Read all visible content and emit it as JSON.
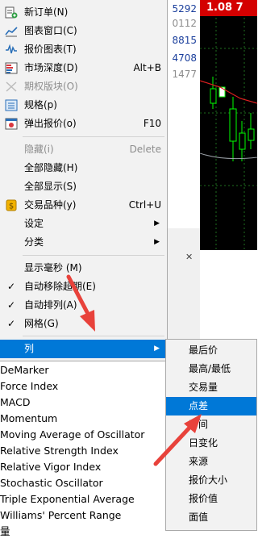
{
  "quotes": [
    "5292",
    "0112",
    "8815",
    "4708",
    "1477"
  ],
  "chart": {
    "price": "1.08 7"
  },
  "menu": {
    "items": [
      {
        "label": "新订单(N)",
        "shortcut": "",
        "icon": "new-order-icon",
        "disabled": false
      },
      {
        "label": "图表窗口(C)",
        "shortcut": "",
        "icon": "chart-window-icon",
        "disabled": false
      },
      {
        "label": "报价图表(T)",
        "shortcut": "",
        "icon": "tick-chart-icon",
        "disabled": false
      },
      {
        "label": "市场深度(D)",
        "shortcut": "Alt+B",
        "icon": "market-depth-icon",
        "disabled": false
      },
      {
        "label": "期权版块(O)",
        "shortcut": "",
        "icon": "options-icon",
        "disabled": true
      },
      {
        "label": "规格(p)",
        "shortcut": "",
        "icon": "specification-icon",
        "disabled": false
      },
      {
        "label": "弹出报价(o)",
        "shortcut": "F10",
        "icon": "popup-prices-icon",
        "disabled": false
      },
      {
        "label": "隐藏(i)",
        "shortcut": "Delete",
        "icon": "",
        "disabled": true
      },
      {
        "label": "全部隐藏(H)",
        "shortcut": "",
        "icon": "",
        "disabled": false
      },
      {
        "label": "全部显示(S)",
        "shortcut": "",
        "icon": "",
        "disabled": false
      },
      {
        "label": "交易品种(y)",
        "shortcut": "Ctrl+U",
        "icon": "symbols-icon",
        "disabled": false
      },
      {
        "label": "设定",
        "shortcut": "",
        "icon": "",
        "disabled": false
      },
      {
        "label": "分类",
        "shortcut": "",
        "icon": "",
        "disabled": false
      },
      {
        "label": "显示毫秒 (M)",
        "shortcut": "",
        "icon": "",
        "disabled": false
      },
      {
        "label": "自动移除超期(E)",
        "shortcut": "",
        "icon": "",
        "disabled": false
      },
      {
        "label": "自动排列(A)",
        "shortcut": "",
        "icon": "",
        "disabled": false
      },
      {
        "label": "网格(G)",
        "shortcut": "",
        "icon": "",
        "disabled": false
      },
      {
        "label": "列",
        "shortcut": "",
        "icon": "",
        "disabled": false
      }
    ],
    "arrow_glyph": "▶",
    "check_glyph": "✓"
  },
  "submenu": {
    "items": [
      "最后价",
      "最高/最低",
      "交易量",
      "点差",
      "时间",
      "日变化",
      "来源",
      "报价大小",
      "报价值",
      "面值"
    ],
    "selected_index": 3
  },
  "indicators": [
    "DeMarker",
    "Force Index",
    "MACD",
    "Momentum",
    "Moving Average of Oscillator",
    "Relative Strength Index",
    "Relative Vigor Index",
    "Stochastic Oscillator",
    "Triple Exponential Average",
    "Williams' Percent Range",
    "量"
  ],
  "panel": {
    "close_glyph": "✕"
  },
  "colors": {
    "highlight": "#0078d7",
    "annotation": "#e8423b",
    "chart_bg": "#000000",
    "price_bg": "#d40000"
  }
}
